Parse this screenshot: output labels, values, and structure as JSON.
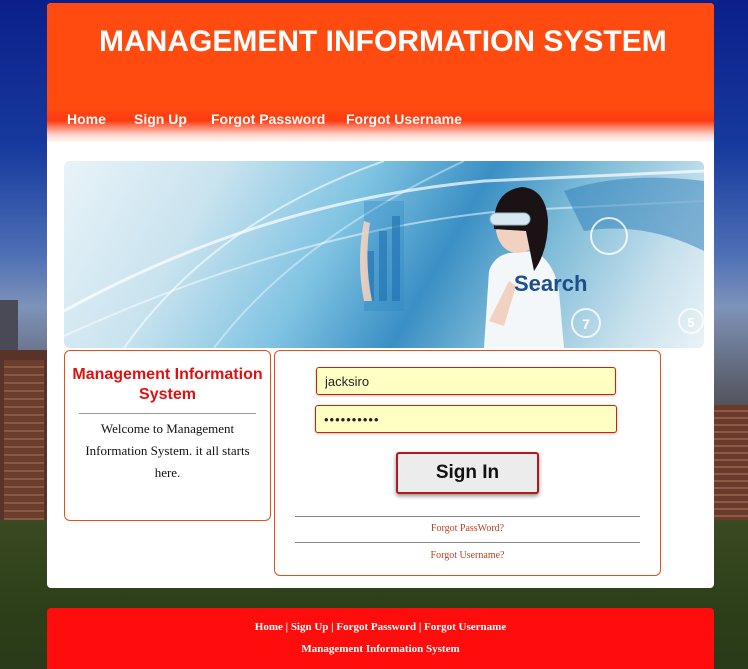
{
  "header": {
    "title": "MANAGEMENT INFORMATION SYSTEM"
  },
  "nav": {
    "items": [
      "Home",
      "Sign Up",
      "Forgot Password",
      "Forgot Username"
    ]
  },
  "banner": {
    "search_text": "Search"
  },
  "info": {
    "title": "Management Information System",
    "text": "Welcome to Management Information System. it all starts here."
  },
  "login": {
    "username_value": "jacksiro",
    "password_value": "••••••••••",
    "signin_label": "Sign In",
    "forgot_password": "Forgot PassWord?",
    "forgot_username": "Forgot Username?"
  },
  "footer": {
    "links": [
      "Home",
      "Sign Up",
      "Forgot Password",
      "Forgot Username"
    ],
    "separator": " | ",
    "copy": "Management Information System"
  },
  "colors": {
    "header": "#ff4a10",
    "footer": "#ff0d0d",
    "accent": "#e01010",
    "input_bg": "#ffffc4"
  }
}
